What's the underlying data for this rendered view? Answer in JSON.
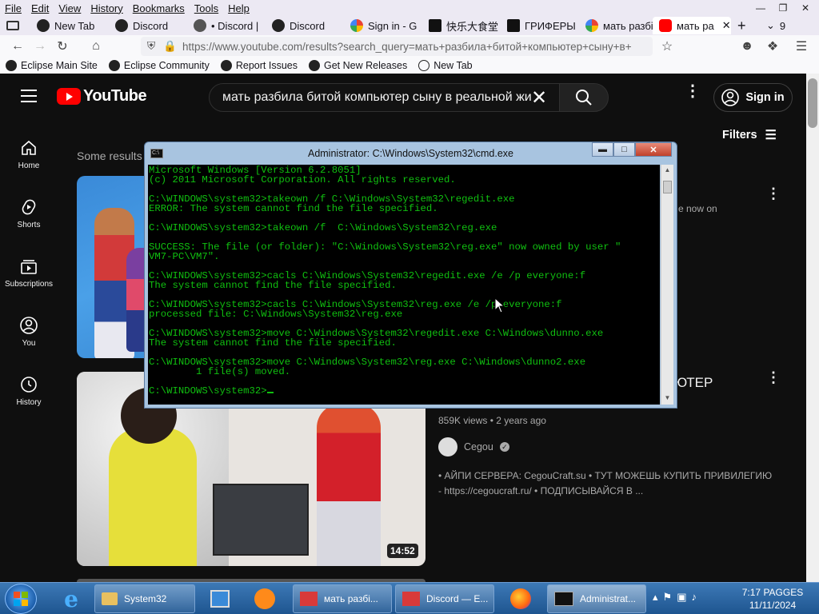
{
  "browser": {
    "menu": [
      "File",
      "Edit",
      "View",
      "History",
      "Bookmarks",
      "Tools",
      "Help"
    ],
    "tabs": [
      {
        "label": "New Tab"
      },
      {
        "label": "Discord"
      },
      {
        "label": "• Discord |"
      },
      {
        "label": "Discord"
      },
      {
        "label": "Sign in - G"
      },
      {
        "label": "快乐大食堂"
      },
      {
        "label": "ГРИФЕРЫ"
      },
      {
        "label": "мать разбі"
      },
      {
        "label": "мать ра"
      }
    ],
    "tab_overflow_count": "9",
    "url": "https://www.youtube.com/results?search_query=мать+разбила+битой+компьютер+сыну+в+",
    "bookmarks": [
      "Eclipse Main Site",
      "Eclipse Community",
      "Report Issues",
      "Get New Releases",
      "New Tab"
    ]
  },
  "youtube": {
    "logo_text": "YouTube",
    "search_value": "мать разбила битой компьютер сыну в реальной жи",
    "signin_label": "Sign in",
    "filters_label": "Filters",
    "sidebar": [
      {
        "label": "Home"
      },
      {
        "label": "Shorts"
      },
      {
        "label": "Subscriptions"
      },
      {
        "label": "You"
      },
      {
        "label": "History"
      }
    ],
    "some_results": "Some results",
    "video1_snippet": "e now on",
    "video2": {
      "title_fragment": "ЮТЕР",
      "views": "859K views",
      "age": "2 years ago",
      "channel": "Cegou",
      "description": "• АЙПИ СЕРВЕРА: CegouCraft.su • ТУТ МОЖЕШЬ КУПИТЬ ПРИВИЛЕГИЮ - https://cegoucraft.ru/ • ПОДПИСЫВАЙСЯ В ...",
      "duration": "14:52"
    }
  },
  "cmd": {
    "title": "Administrator: C:\\Windows\\System32\\cmd.exe",
    "lines": [
      "Microsoft Windows [Version 6.2.8051]",
      "(c) 2011 Microsoft Corporation. All rights reserved.",
      "",
      "C:\\WINDOWS\\system32>takeown /f C:\\Windows\\System32\\regedit.exe",
      "ERROR: The system cannot find the file specified.",
      "",
      "C:\\WINDOWS\\system32>takeown /f  C:\\Windows\\System32\\reg.exe",
      "",
      "SUCCESS: The file (or folder): \"C:\\Windows\\System32\\reg.exe\" now owned by user \"",
      "VM7-PC\\VM7\".",
      "",
      "C:\\WINDOWS\\system32>cacls C:\\Windows\\System32\\regedit.exe /e /p everyone:f",
      "The system cannot find the file specified.",
      "",
      "C:\\WINDOWS\\system32>cacls C:\\Windows\\System32\\reg.exe /e /p everyone:f",
      "processed file: C:\\Windows\\System32\\reg.exe",
      "",
      "C:\\WINDOWS\\system32>move C:\\Windows\\System32\\regedit.exe C:\\Windows\\dunno.exe",
      "The system cannot find the file specified.",
      "",
      "C:\\WINDOWS\\system32>move C:\\Windows\\System32\\reg.exe C:\\Windows\\dunno2.exe",
      "        1 file(s) moved.",
      "",
      "C:\\WINDOWS\\system32>"
    ]
  },
  "taskbar": {
    "tasks": [
      {
        "label": "System32"
      },
      {
        "label": "мать разбі..."
      },
      {
        "label": "Discord — E..."
      },
      {
        "label": "Administrat..."
      }
    ],
    "clock_time": "7:17 PAGGES",
    "clock_date": "11/11/2024"
  },
  "colors": {
    "youtube_red": "#ff0000",
    "console_text": "#10c010",
    "page_bg": "#0f0f0f"
  }
}
